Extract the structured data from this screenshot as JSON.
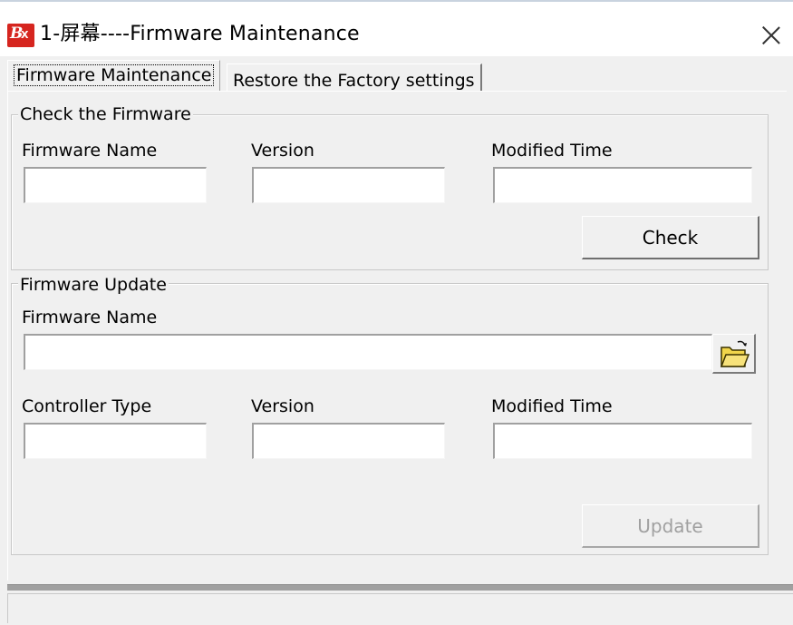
{
  "window": {
    "title": "1-屏幕----Firmware Maintenance",
    "app_icon": "bx-logo-icon",
    "close_icon": "close-icon"
  },
  "tabs": [
    {
      "label": "Firmware Maintenance",
      "active": true
    },
    {
      "label": "Restore the Factory settings",
      "active": false
    }
  ],
  "check_group": {
    "legend": "Check the Firmware",
    "firmware_name_label": "Firmware Name",
    "firmware_name_value": "",
    "version_label": "Version",
    "version_value": "",
    "modified_time_label": "Modified Time",
    "modified_time_value": "",
    "check_button": "Check"
  },
  "update_group": {
    "legend": "Firmware Update",
    "firmware_name_label": "Firmware Name",
    "firmware_name_value": "",
    "browse_icon": "open-folder-icon",
    "controller_type_label": "Controller Type",
    "controller_type_value": "",
    "version_label": "Version",
    "version_value": "",
    "modified_time_label": "Modified Time",
    "modified_time_value": "",
    "update_button": "Update",
    "update_enabled": false
  },
  "colors": {
    "window_bg": "#f0f0f0",
    "icon_red": "#d6251f",
    "disabled_text": "#a0a0a0"
  }
}
